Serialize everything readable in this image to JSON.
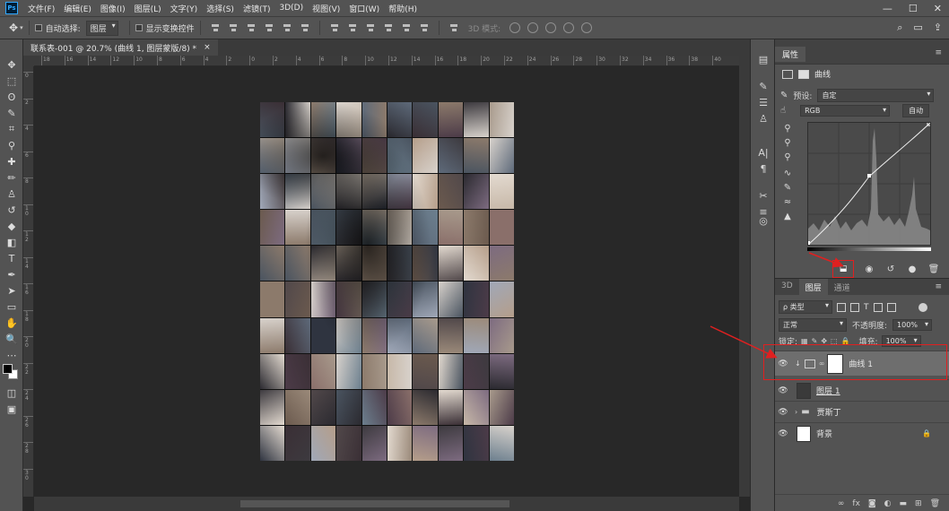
{
  "app": {
    "logo": "Ps"
  },
  "menu": [
    "文件(F)",
    "编辑(E)",
    "图像(I)",
    "图层(L)",
    "文字(Y)",
    "选择(S)",
    "滤镜(T)",
    "3D(D)",
    "视图(V)",
    "窗口(W)",
    "帮助(H)"
  ],
  "window_controls": {
    "minimize": "—",
    "maximize": "☐",
    "close": "✕"
  },
  "options": {
    "auto_select_label": "自动选择:",
    "auto_select_value": "图层",
    "show_transform_label": "显示变换控件",
    "mode_3d_label": "3D 模式:"
  },
  "document": {
    "tab_title": "联系表-001 @ 20.7% (曲线 1, 图层蒙版/8) *",
    "close": "×"
  },
  "ruler_h_ticks": [
    "18",
    "16",
    "14",
    "12",
    "10",
    "8",
    "6",
    "4",
    "2",
    "0",
    "2",
    "4",
    "6",
    "8",
    "10",
    "12",
    "14",
    "16",
    "18",
    "20",
    "22",
    "24",
    "26",
    "28",
    "30",
    "32",
    "34",
    "36",
    "38",
    "40"
  ],
  "ruler_v_ticks": [
    "0",
    "2",
    "4",
    "6",
    "8",
    "1 0",
    "1 2",
    "1 4",
    "1 6",
    "1 8",
    "2 0",
    "2 2",
    "2 4",
    "2 6",
    "2 8",
    "3 0"
  ],
  "properties": {
    "tab": "属性",
    "adjustment_name": "曲线",
    "preset_label": "预设:",
    "preset_value": "自定",
    "channel_value": "RGB",
    "auto_button": "自动"
  },
  "layers_panel": {
    "tabs": [
      "3D",
      "图层",
      "通道"
    ],
    "active_tab": "图层",
    "filter_kind": "ρ 类型",
    "blend_mode": "正常",
    "opacity_label": "不透明度:",
    "opacity_value": "100%",
    "lock_label": "锁定:",
    "fill_label": "填充:",
    "fill_value": "100%",
    "layers": [
      {
        "name": "曲线 1",
        "selected": true
      },
      {
        "name": "图层 1",
        "selected": false
      },
      {
        "name": "贾斯丁",
        "selected": false,
        "group": true
      },
      {
        "name": "背景",
        "selected": false,
        "locked": true
      }
    ],
    "footer_fx": "fx"
  },
  "colors": {
    "annotation_red": "#e02020",
    "panel_bg": "#535353",
    "canvas_bg": "#282828"
  }
}
